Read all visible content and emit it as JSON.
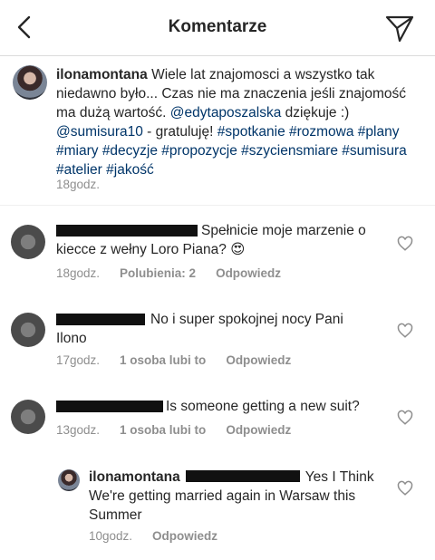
{
  "header": {
    "title": "Komentarze",
    "back_icon": "chevron-left-icon",
    "share_icon": "paper-plane-icon"
  },
  "caption": {
    "username": "ilonamontana",
    "text_1": " Wiele lat znajomosci a wszystko tak niedawno było... Czas nie ma znaczenia jeśli znajomość ma dużą wartość. ",
    "mention_1": "@edytaposzalska",
    "text_2": " dziękuje :) ",
    "mention_2": "@sumisura10",
    "text_3": " - gratuluję! ",
    "hashtags": "#spotkanie #rozmowa #plany #miary #decyzje #propozycje #szyciensmiare #sumisura #atelier #jakość",
    "time": "18godz."
  },
  "comments": [
    {
      "text": "Spełnicie moje marzenie o kiecce z wełny Loro Piana? 😍",
      "time": "18godz.",
      "likes": "Polubienia: 2",
      "reply": "Odpowiedz"
    },
    {
      "text": "No i super spokojnej nocy Pani Ilono",
      "time": "17godz.",
      "likes": "1 osoba lubi to",
      "reply": "Odpowiedz"
    },
    {
      "text": "Is someone getting a new suit?",
      "time": "13godz.",
      "likes": "1 osoba lubi to",
      "reply": "Odpowiedz"
    }
  ],
  "reply": {
    "username": "ilonamontana",
    "text": "Yes I Think We're getting married again in Warsaw this Summer",
    "time": "10godz.",
    "reply": "Odpowiedz"
  },
  "colors": {
    "text": "#262626",
    "secondary": "#8e8e8e",
    "link": "#003569",
    "divider": "#efefef"
  }
}
